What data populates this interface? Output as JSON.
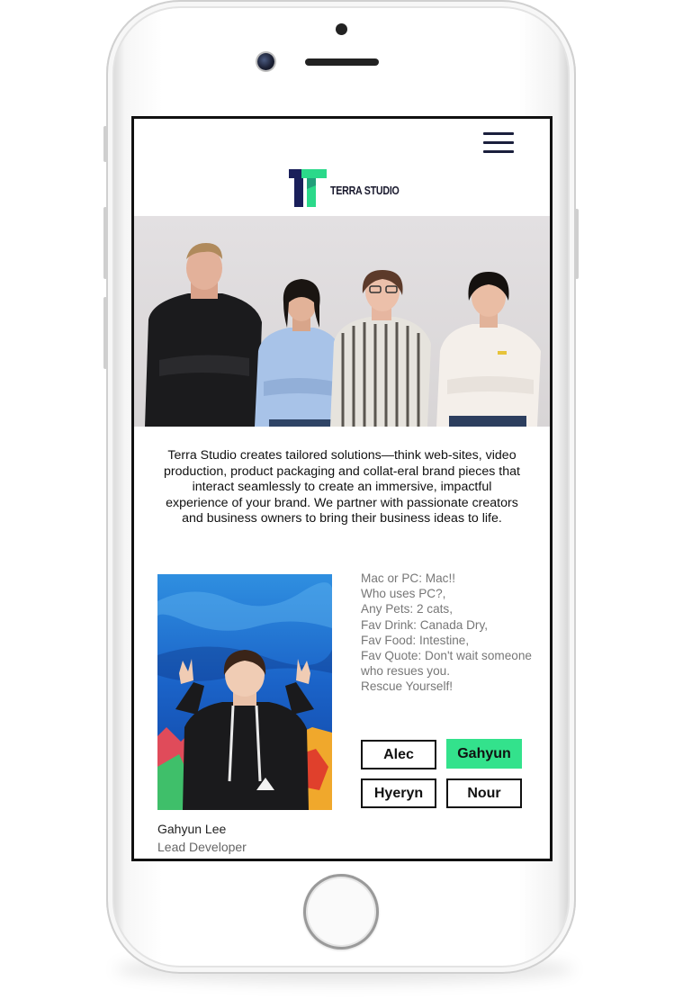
{
  "brand": {
    "name": "TERRA STUDIO",
    "logo_colors": {
      "primary": "#1a1f5a",
      "accent": "#2bd98a"
    }
  },
  "header": {
    "menu_icon": "hamburger-menu-icon"
  },
  "hero": {
    "image": "team-group-photo"
  },
  "intro": {
    "text": "Terra Studio creates tailored solutions—think web-sites, video production, product packaging and collat-eral brand pieces that interact seamlessly to create an immersive, impactful experience of your brand. We partner with passionate creators and business owners to bring their business ideas to life."
  },
  "member": {
    "name": "Gahyun Lee",
    "role": "Lead Developer",
    "facts": [
      "Mac or PC: Mac!!",
      "Who uses PC?,",
      "Any Pets: 2 cats,",
      "Fav Drink: Canada Dry,",
      "Fav Food: Intestine,",
      "Fav Quote: Don't wait someone",
      "who resues you.",
      "Rescue Yourself!"
    ]
  },
  "team_buttons": [
    {
      "label": "Alec",
      "active": false
    },
    {
      "label": "Gahyun",
      "active": true
    },
    {
      "label": "Hyeryn",
      "active": false
    },
    {
      "label": "Nour",
      "active": false
    }
  ],
  "colors": {
    "active_button": "#33e28c",
    "text": "#111111",
    "muted": "#777777"
  }
}
